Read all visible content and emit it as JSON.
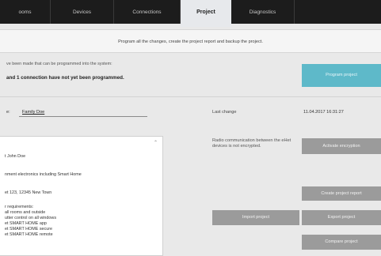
{
  "tabs": [
    {
      "label": "ooms",
      "active": false
    },
    {
      "label": "Devices",
      "active": false
    },
    {
      "label": "Connections",
      "active": false
    },
    {
      "label": "Project",
      "active": true
    },
    {
      "label": "Diagnostics",
      "active": false
    }
  ],
  "info_bar": "Program all the changes, create the project report and backup the project.",
  "notice": {
    "line1": "ve been made that can be programmed into the system:",
    "line2": "and 1 connection have not yet been programmed."
  },
  "buttons": {
    "program_project": "Program project",
    "activate_encryption": "Activate encryption",
    "create_project_report": "Create project report",
    "import_project": "Import project",
    "export_project": "Export project",
    "compare_project": "Compare project"
  },
  "project": {
    "name_label": "e:",
    "name_value": "Family Doe",
    "last_change_label": "Last change",
    "last_change_value": "11.04.2017 16:31:27"
  },
  "description_lines": [
    "t John Doe",
    "nment electronics including Smart Home",
    "et 123, 12345 New Town",
    "r requirements:",
    "all rooms and outside",
    "utter control on all windows",
    "et SMART HOME app",
    "et SMART HOME secure",
    "et SMART HOME remote"
  ],
  "radio_text": "Radio communication between the eHet devices is not encrypted.",
  "colors": {
    "accent_teal": "#5eb9c9",
    "tab_bar": "#1c1c1c",
    "button_gray": "#9b9b9b"
  }
}
